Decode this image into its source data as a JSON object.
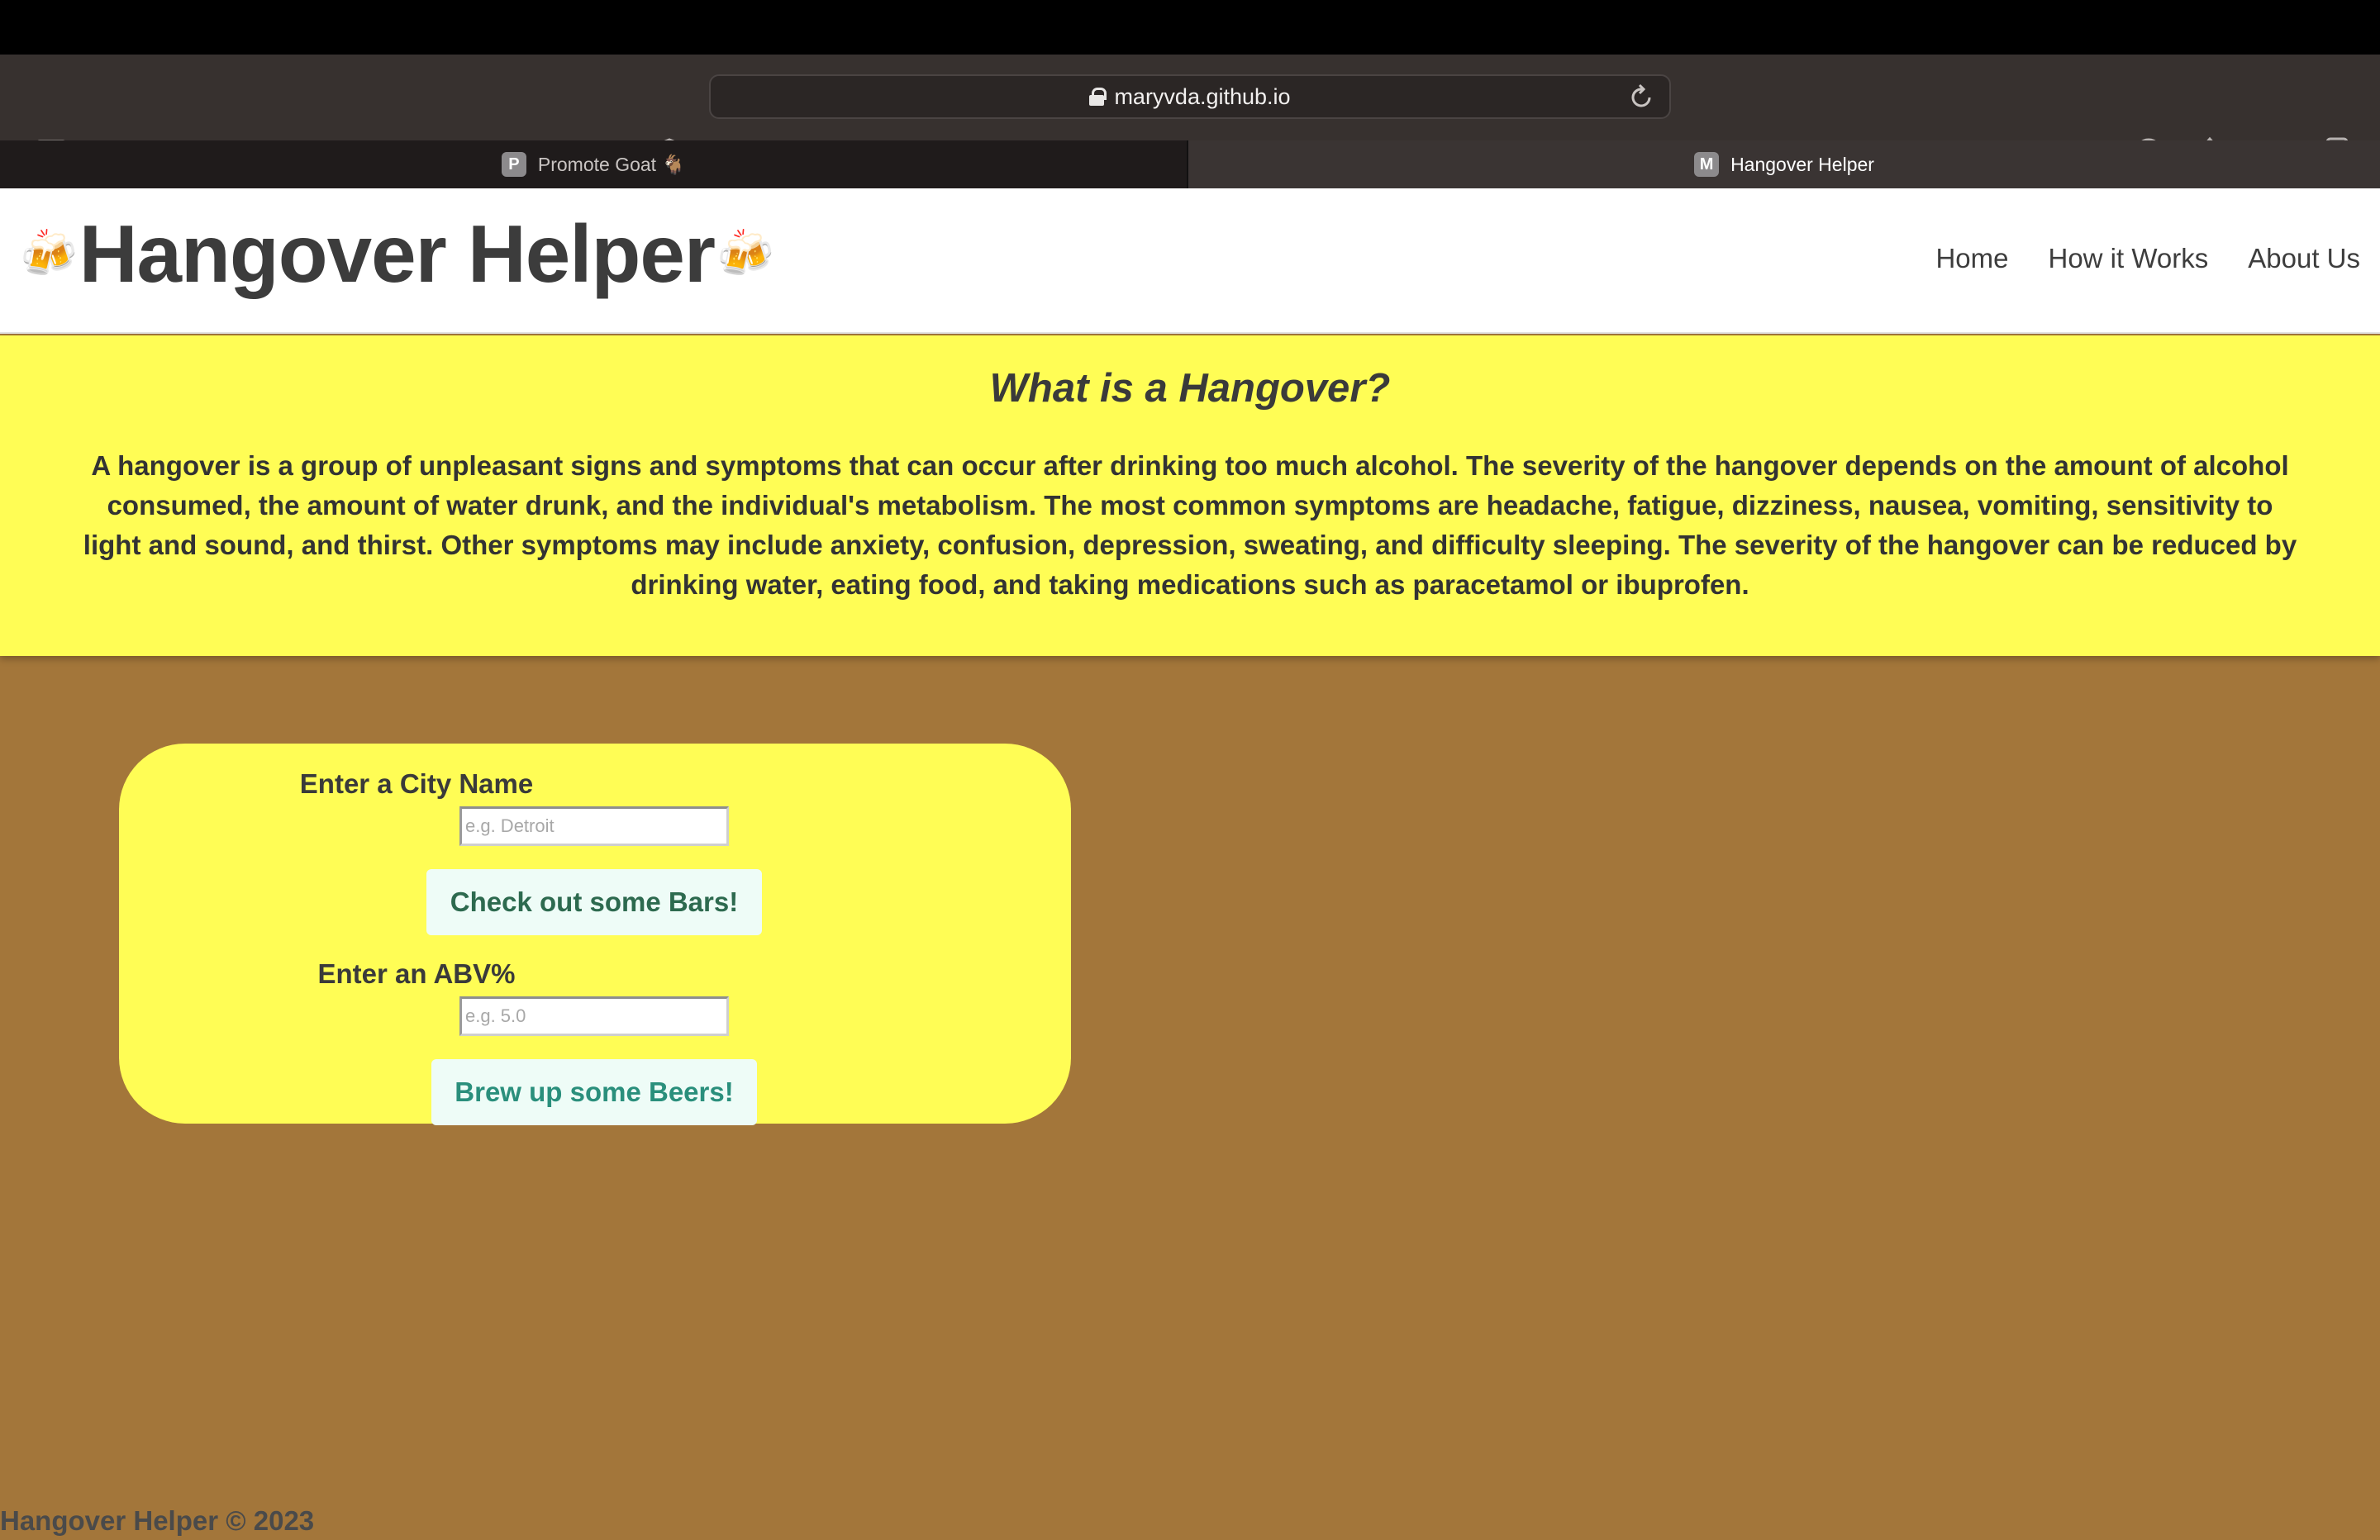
{
  "browser": {
    "url": "maryvda.github.io",
    "tabs": [
      {
        "favicon": "P",
        "title": "Promote Goat 🐐",
        "active": false
      },
      {
        "favicon": "M",
        "title": "Hangover Helper",
        "active": true
      }
    ],
    "icons": [
      "sidebar-icon",
      "chevron-down-icon",
      "back-icon",
      "forward-icon",
      "shield-icon",
      "lock-icon",
      "reload-icon",
      "download-icon",
      "share-icon",
      "new-tab-icon",
      "tab-overview-icon"
    ]
  },
  "header": {
    "title": "Hangover Helper",
    "logo_emoji": "🍻",
    "nav": [
      "Home",
      "How it Works",
      "About Us"
    ]
  },
  "info": {
    "heading": "What is a Hangover?",
    "body": "A hangover is a group of unpleasant signs and symptoms that can occur after drinking too much alcohol. The severity of the hangover depends on the amount of alcohol consumed, the amount of water drunk, and the individual's metabolism. The most common symptoms are headache, fatigue, dizziness, nausea, vomiting, sensitivity to light and sound, and thirst. Other symptoms may include anxiety, confusion, depression, sweating, and difficulty sleeping. The severity of the hangover can be reduced by drinking water, eating food, and taking medications such as paracetamol or ibuprofen."
  },
  "form": {
    "city_label": "Enter a City Name",
    "city_placeholder": "e.g. Detroit",
    "city_value": "",
    "bars_button": "Check out some Bars!",
    "abv_label": "Enter an ABV%",
    "abv_placeholder": "e.g. 5.0",
    "abv_value": "",
    "beers_button": "Brew up some Beers!"
  },
  "footer": {
    "text": "Hangover Helper © 2023"
  },
  "colors": {
    "page_bg": "#a3763a",
    "panel_yellow": "#fffd55",
    "button_bg": "#eefcf7",
    "bars_text": "#2d6a4f",
    "beers_text": "#2a8f7c"
  }
}
